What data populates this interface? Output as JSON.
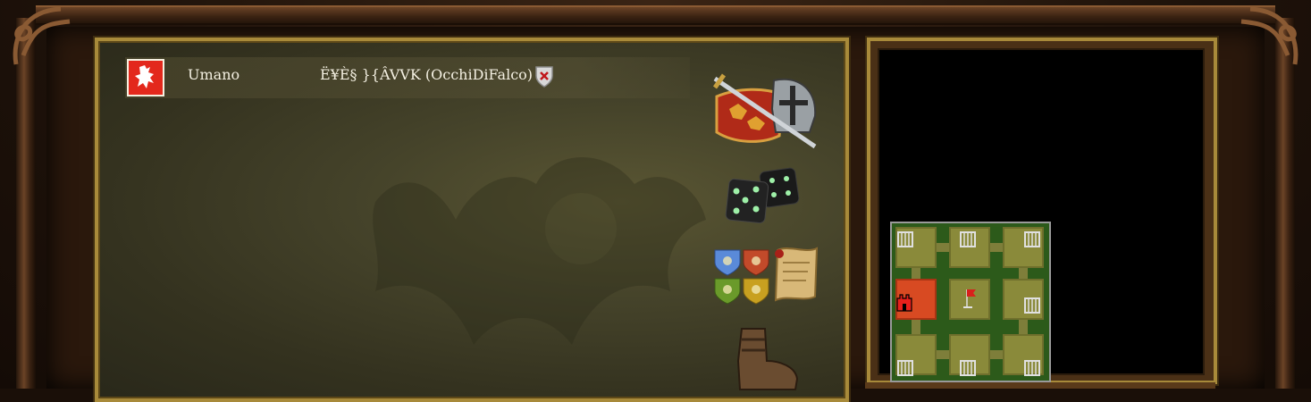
{
  "player": {
    "type": "Umano",
    "name": "Ë¥È§ }{ÂVVK (OcchiDiFalco)",
    "emblem_color": "#e3281c"
  },
  "icons": {
    "battle": "sword-shield-helmet-icon",
    "dice": "dice-icon",
    "teams": "team-shields-icon",
    "scroll": "map-scroll-icon",
    "boot": "boot-icon",
    "kick": "kick-player-icon"
  },
  "colors": {
    "frame_gold": "#a88a3a",
    "panel_olive": "#45432a",
    "minimap_grass": "#2c5a1a"
  }
}
